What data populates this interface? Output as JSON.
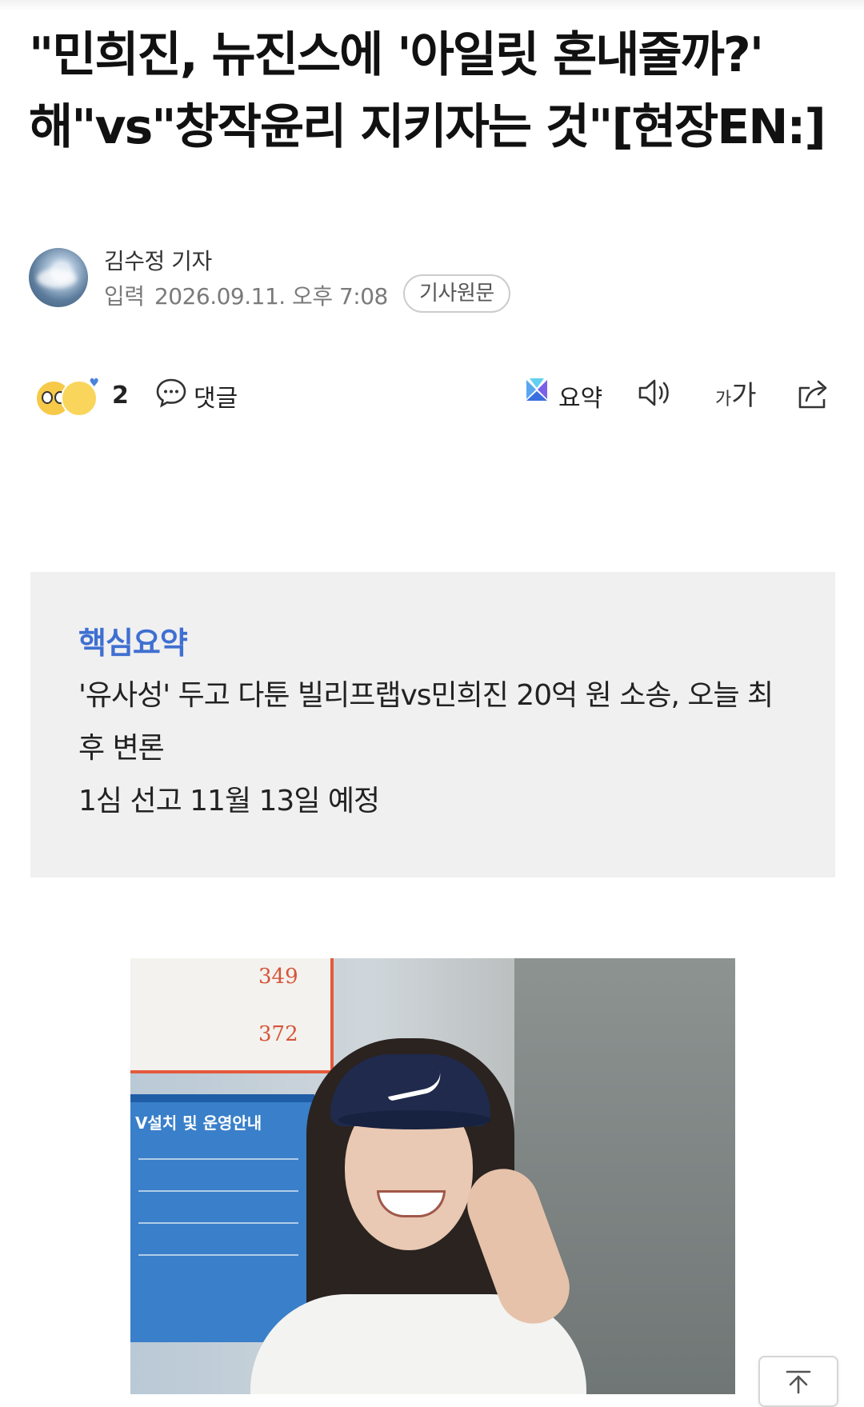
{
  "article": {
    "headline": "\"민희진, 뉴진스에 '아일릿 혼내줄까?' 해\"vs\"창작윤리 지키자는 것\"[현장EN:]",
    "author": "김수정 기자",
    "date_label": "입력",
    "date_value": "2026.09.11. 오후 7:08",
    "source_button": "기사원문"
  },
  "actions": {
    "reaction_count": "2",
    "comment_label": "댓글",
    "summary_label": "요약",
    "font_small": "가",
    "font_big": "가"
  },
  "summary": {
    "title": "핵심요약",
    "items": [
      "'유사성' 두고 다툰 빌리프랩vs민희진 20억 원 소송, 오늘 최후 변론",
      "1심 선고 11월 13일 예정"
    ]
  },
  "photo": {
    "board_numbers": [
      "349",
      "372"
    ],
    "sign_title": "V설치 및 운영안내"
  },
  "colors": {
    "summary_title": "#3f6fd1",
    "summary_bg": "#f0f0f1",
    "text": "#111111",
    "meta_text": "#7a7a7a"
  },
  "icons": {
    "comment": "speech-bubble-icon",
    "summary": "ai-summary-icon",
    "listen": "speaker-icon",
    "share": "share-icon",
    "scroll_top": "arrow-up-icon"
  }
}
